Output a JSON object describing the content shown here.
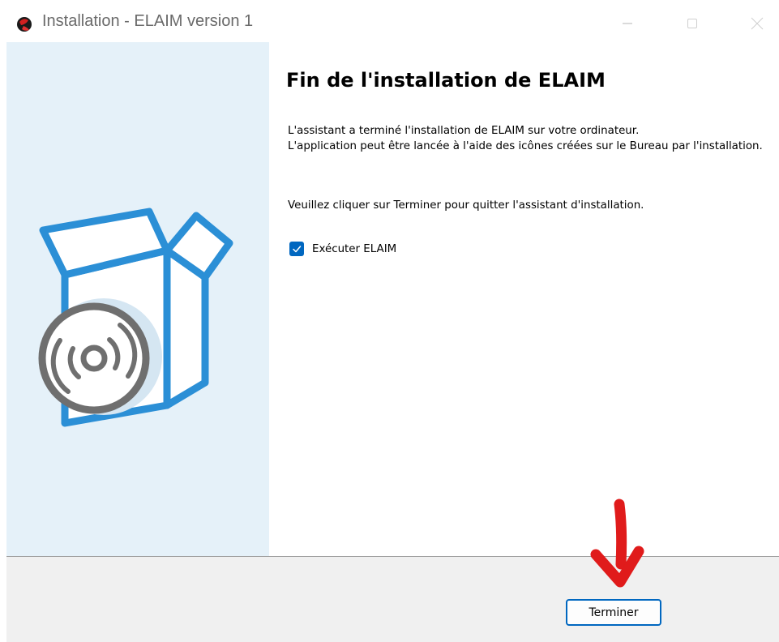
{
  "window": {
    "title": "Installation - ELAIM version 1",
    "controls": [
      "minimize-icon",
      "maximize-icon",
      "close-icon"
    ]
  },
  "content": {
    "heading": "Fin de l'installation de ELAIM",
    "paragraph1_line1": "L'assistant a terminé l'installation de ELAIM sur votre ordinateur.",
    "paragraph1_line2": "L'application peut être lancée à l'aide des icônes créées sur le Bureau par l'installation.",
    "paragraph2": "Veuillez cliquer sur Terminer pour quitter l'assistant d'installation.",
    "run_checkbox": {
      "label": "Exécuter ELAIM",
      "checked": true
    }
  },
  "footer": {
    "finish_label": "Terminer"
  },
  "colors": {
    "accent": "#0067c0",
    "banner_bg": "#e5f1f9",
    "box_outline": "#2b8fd6",
    "disc_gray": "#6f6f6f",
    "annotation_arrow": "#e01b1b"
  },
  "icons": {
    "app": "elaim-app-icon",
    "banner": "software-box-disc-icon",
    "annotation": "red-arrow-down-icon"
  }
}
